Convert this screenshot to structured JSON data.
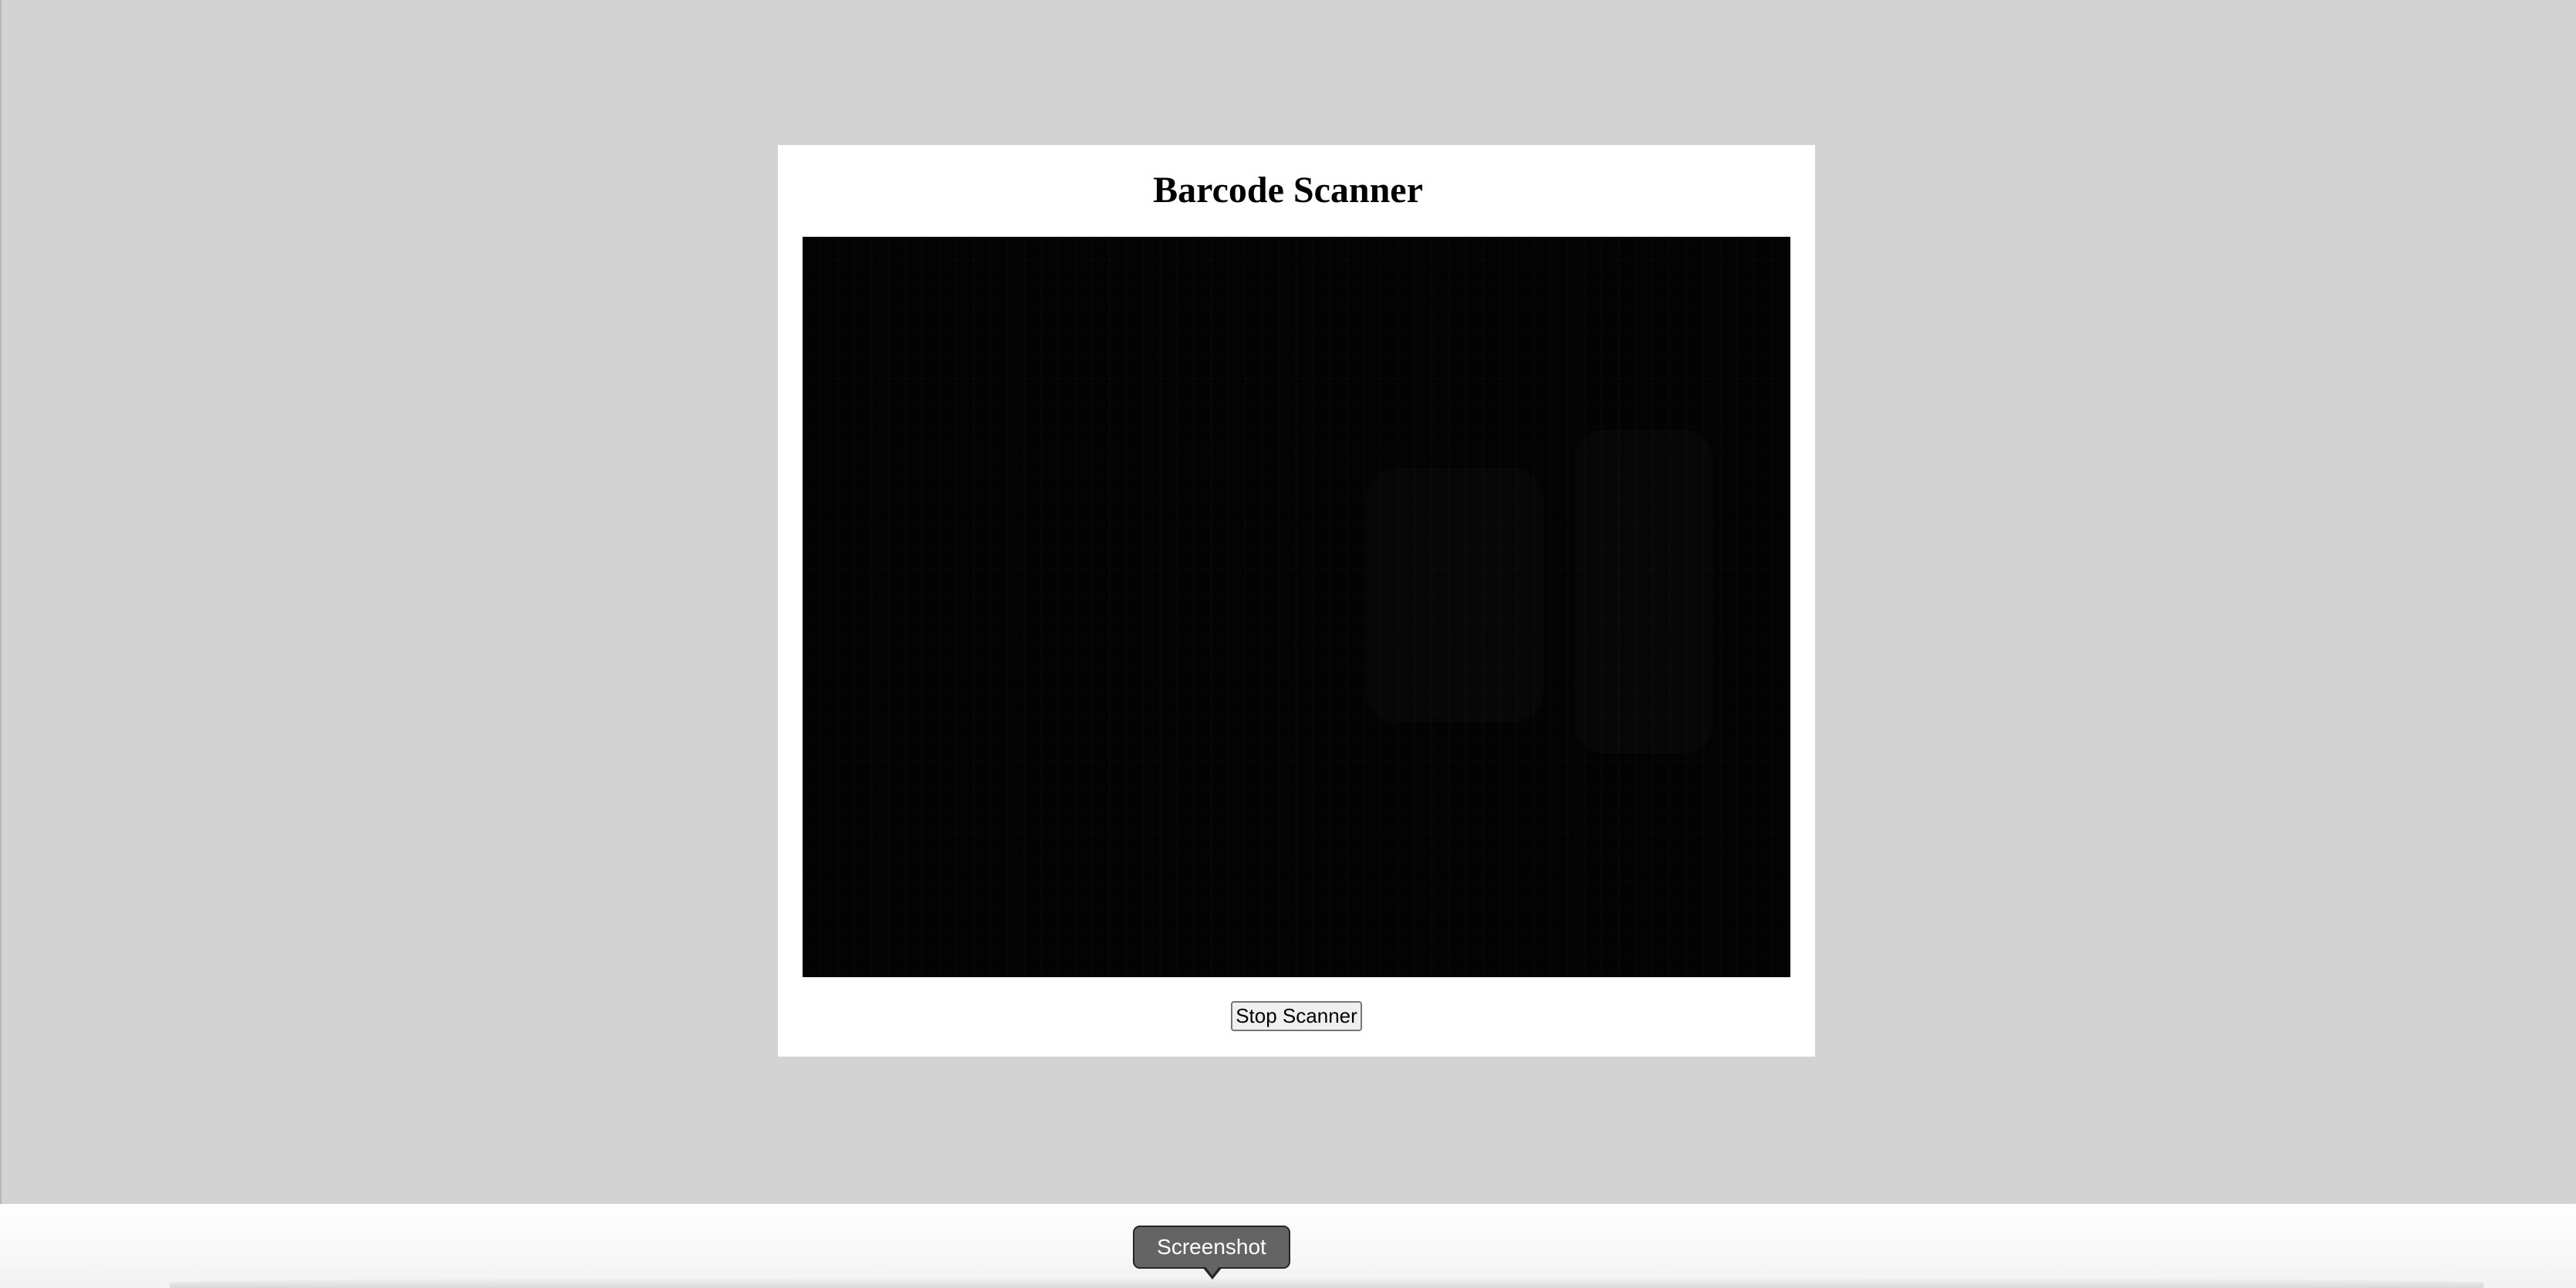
{
  "page": {
    "title": "Barcode Scanner",
    "background_color": "#d3d3d3"
  },
  "scanner": {
    "video_background": "#030303",
    "stop_label": "Stop Scanner"
  },
  "dock": {
    "tooltip_label": "Screenshot",
    "tooltip_color": "#646464"
  }
}
